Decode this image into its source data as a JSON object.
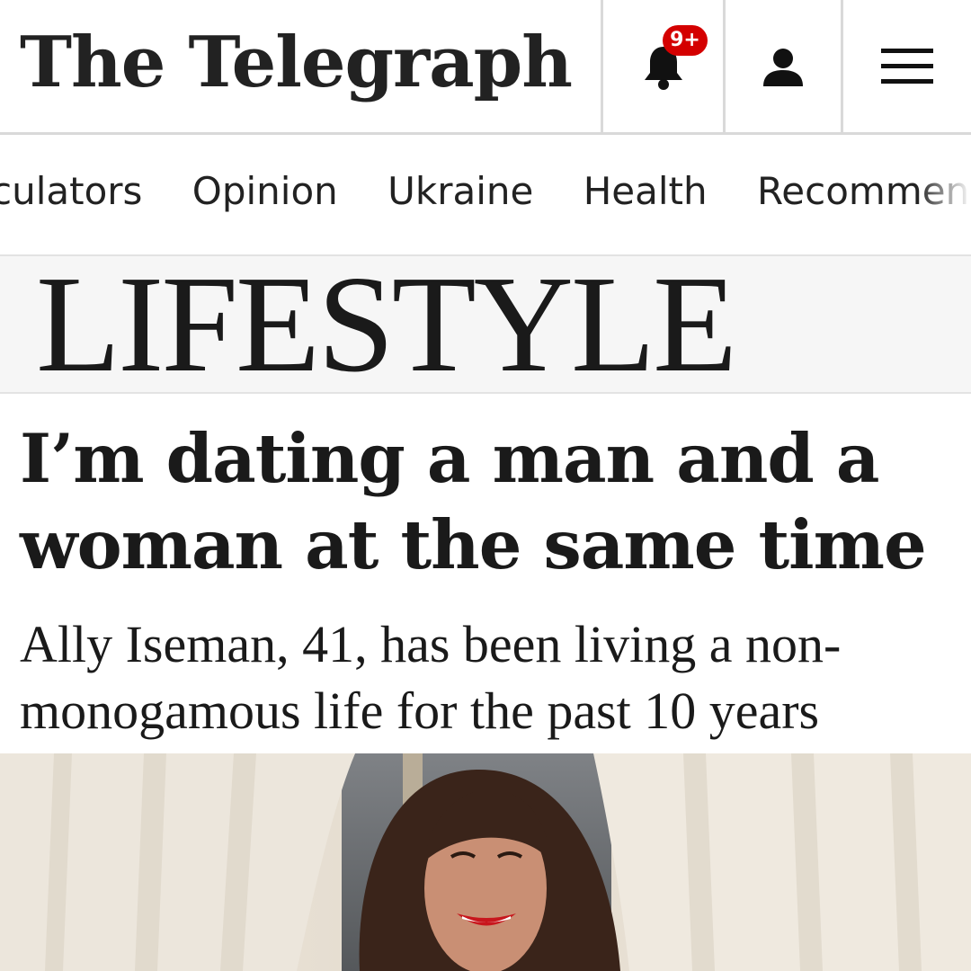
{
  "header": {
    "logo_text": "The Telegraph",
    "notifications_badge": "9+",
    "icons": [
      "bell-icon",
      "account-icon",
      "hamburger-menu-icon"
    ]
  },
  "nav": {
    "items": [
      "Calculators",
      "Opinion",
      "Ukraine",
      "Health",
      "Recommended"
    ],
    "visible_partial_first": "culators",
    "visible_partial_last": "Recommende"
  },
  "section": {
    "title": "LIFESTYLE"
  },
  "article": {
    "headline_line1": "I’m dating a man and a",
    "headline_line2": "woman at the same time",
    "standfirst_line1": "Ally Iseman, 41, has been living a non-",
    "standfirst_line2": "monogamous life for the past 10 years"
  },
  "colors": {
    "badge": "#d40000",
    "text": "#1a1a1a",
    "section_bg": "#f6f6f6",
    "divider": "#d9d9d9"
  }
}
